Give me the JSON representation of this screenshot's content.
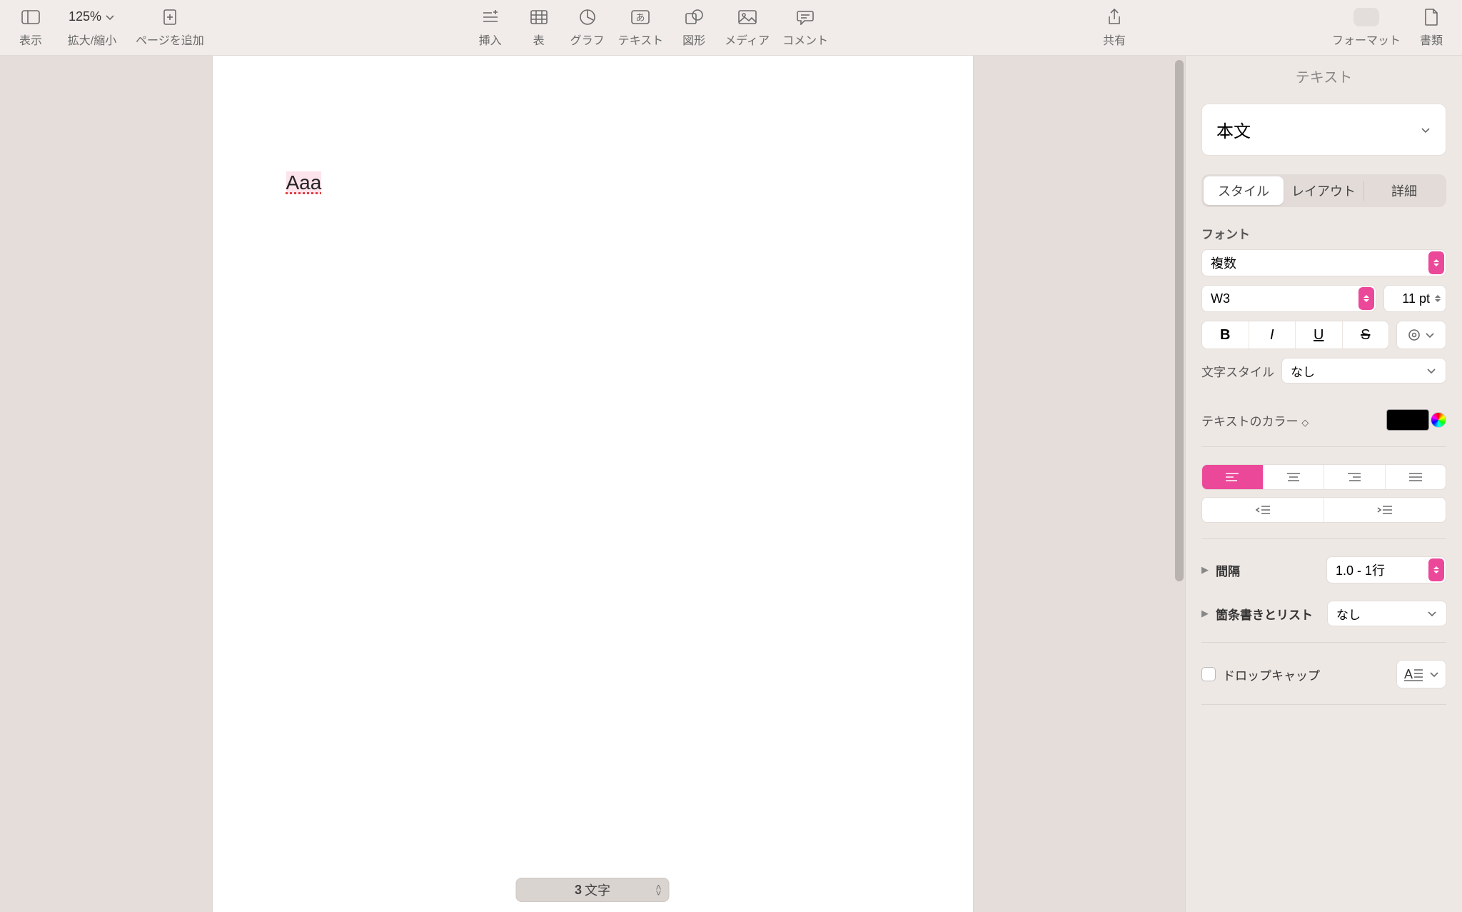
{
  "toolbar": {
    "view": "表示",
    "zoom_value": "125%",
    "zoom_label": "拡大/縮小",
    "add_page": "ページを追加",
    "insert": "挿入",
    "table": "表",
    "chart": "グラフ",
    "text": "テキスト",
    "shape": "図形",
    "media": "メディア",
    "comment": "コメント",
    "share": "共有",
    "format": "フォーマット",
    "document": "書類"
  },
  "doc": {
    "text": "Aaa",
    "char_count": "3",
    "char_label": "文字"
  },
  "inspector": {
    "title": "テキスト",
    "paragraph_style": "本文",
    "tabs": {
      "style": "スタイル",
      "layout": "レイアウト",
      "more": "詳細"
    },
    "font": {
      "section": "フォント",
      "family": "複数",
      "typeface": "W3",
      "size": "11 pt",
      "char_style_label": "文字スタイル",
      "char_style_value": "なし"
    },
    "text_color_label": "テキストのカラー",
    "spacing": {
      "label": "間隔",
      "value": "1.0 - 1行"
    },
    "bullets": {
      "label": "箇条書きとリスト",
      "value": "なし"
    },
    "dropcap": {
      "label": "ドロップキャップ"
    }
  },
  "colors": {
    "accent": "#ec4899",
    "text_color": "#000000"
  }
}
